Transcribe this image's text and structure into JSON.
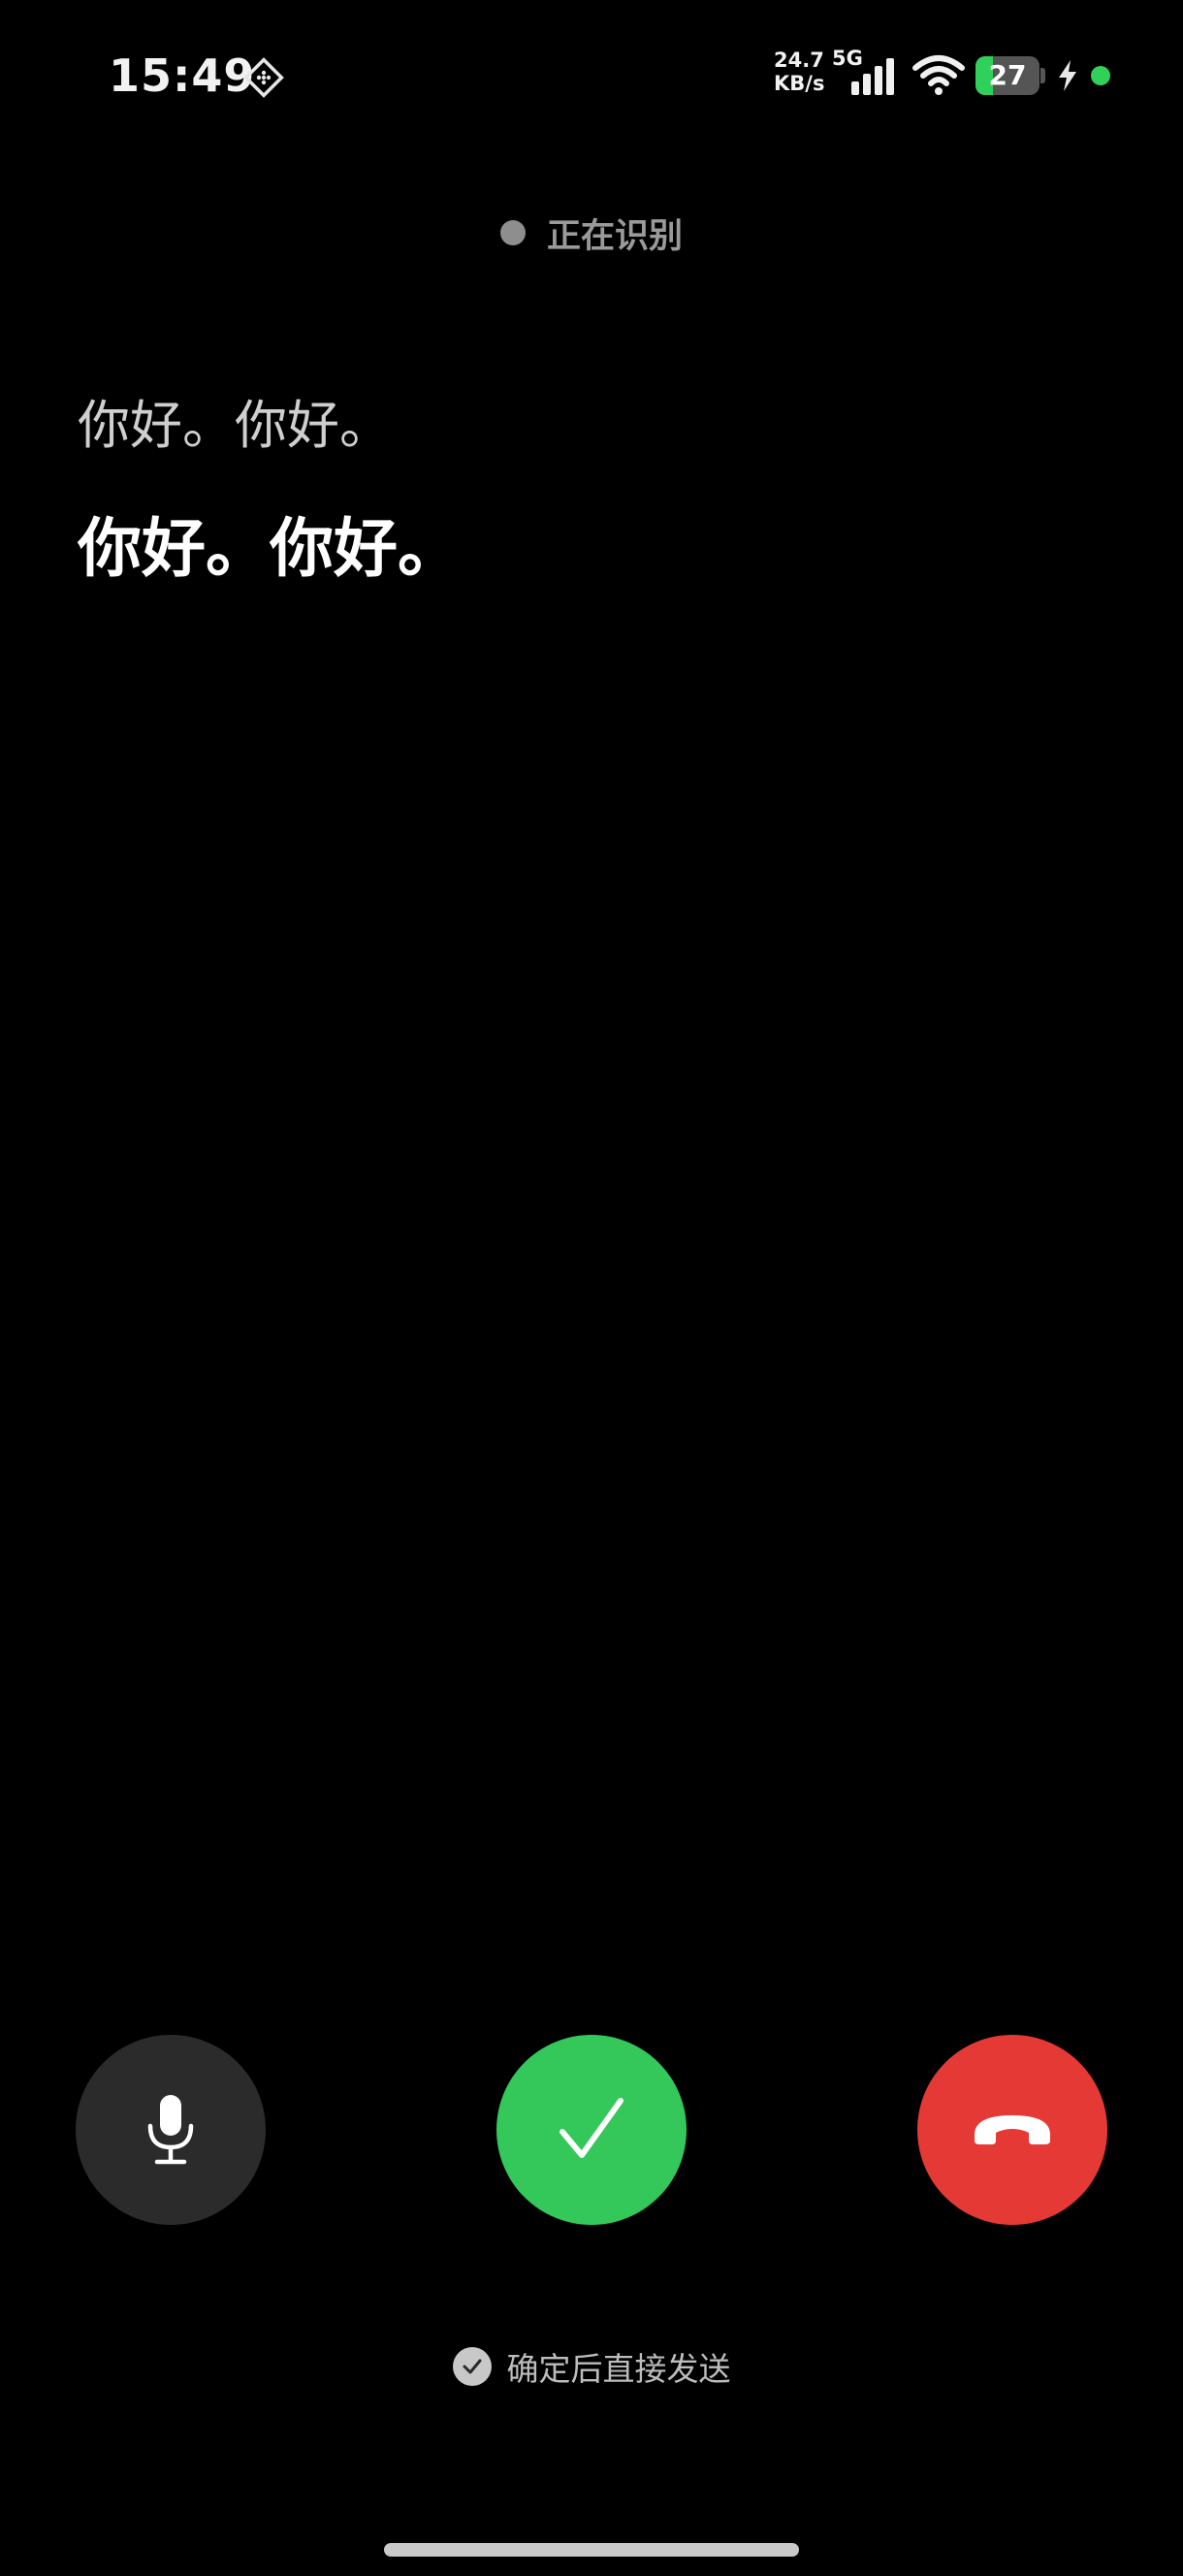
{
  "status_bar": {
    "time": "15:49",
    "net_speed": "24.7 KB/s",
    "net_type": "5G",
    "battery_level": "27",
    "battery_fraction": 0.27,
    "icons": {
      "app": "app-diamond-icon",
      "signal": "cellular-signal-icon",
      "wifi": "wifi-icon",
      "charging": "charging-bolt-icon",
      "privacy": "privacy-indicator-dot"
    }
  },
  "recognition": {
    "status_text": "正在识别"
  },
  "transcript": {
    "secondary": "你好。你好。",
    "primary": "你好。你好。"
  },
  "actions": {
    "mic": {
      "icon": "microphone-icon",
      "color": "#2b2b2b"
    },
    "confirm": {
      "icon": "checkmark-icon",
      "color": "#34c759"
    },
    "hangup": {
      "icon": "hang-up-phone-icon",
      "color": "#e53935"
    }
  },
  "footer": {
    "send_option_label": "确定后直接发送",
    "send_option_checked": true
  },
  "colors": {
    "background": "#000000",
    "battery_green": "#2fd15a"
  }
}
